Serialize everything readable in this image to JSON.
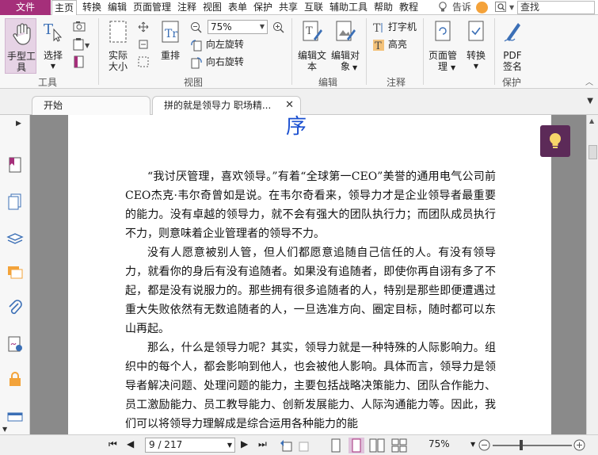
{
  "menubar": {
    "file": "文件",
    "items": [
      "主页",
      "转换",
      "编辑",
      "页面管理",
      "注释",
      "视图",
      "表单",
      "保护",
      "共享",
      "互联",
      "辅助工具",
      "帮助",
      "教程"
    ],
    "tell_me": "告诉",
    "search_placeholder": "查找"
  },
  "ribbon": {
    "hand_tool": "手型工具",
    "select": "选择",
    "actual_size": "实际大小",
    "reflow": "重排",
    "zoom_value": "75%",
    "rotate_left": "向左旋转",
    "rotate_right": "向右旋转",
    "edit_text": "编辑文本",
    "edit_object": "编辑对象",
    "typewriter": "打字机",
    "highlight": "高亮",
    "page_manage": "页面管理",
    "convert": "转换",
    "pdf_sign": "PDF签名",
    "groups": {
      "tools": "工具",
      "view": "视图",
      "edit": "编辑",
      "comment": "注释",
      "protect": "保护"
    }
  },
  "tabs": [
    {
      "label": "开始"
    },
    {
      "label": "拼的就是领导力 职场精..."
    }
  ],
  "document": {
    "chapter": "序",
    "paragraphs": [
      "“我讨厌管理，喜欢领导。”有着“全球第一CEO”美誉的通用电气公司前CEO杰克·韦尔奇曾如是说。在韦尔奇看来，领导力才是企业领导者最重要的能力。没有卓越的领导力，就不会有强大的团队执行力；而团队成员执行不力，则意味着企业管理者的领导不力。",
      "没有人愿意被别人管，但人们都愿意追随自己信任的人。有没有领导力，就看你的身后有没有追随者。如果没有追随者，即使你再自诩有多了不起，都是没有说服力的。那些拥有很多追随者的人，特别是那些即便遭遇过重大失败依然有无数追随者的人，一旦选准方向、圈定目标，随时都可以东山再起。",
      "那么，什么是领导力呢？其实，领导力就是一种特殊的人际影响力。组织中的每个人，都会影响到他人，也会被他人影响。具体而言，领导力是领导者解决问题、处理问题的能力，主要包括战略决策能力、团队合作能力、员工激励能力、员工教导能力、创新发展能力、人际沟通能力等。因此，我们可以将领导力理解成是综合运用各种能力的能"
    ]
  },
  "statusbar": {
    "page": "9 / 217",
    "zoom": "75%"
  },
  "colors": {
    "brand": "#a52f7a",
    "lightbulb_bg": "#5c2a58",
    "chapter_title": "#1a4fd0"
  }
}
